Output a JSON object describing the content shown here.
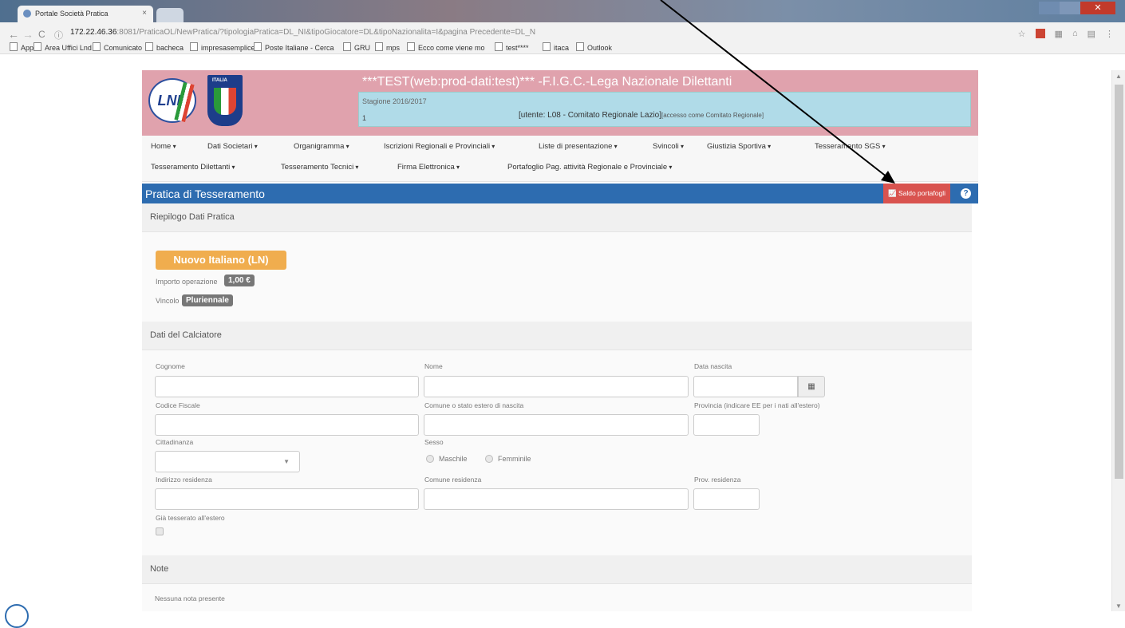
{
  "browser": {
    "tab_title": "Portale Società Pratica",
    "tab_close": "×",
    "close_glyph": "✕",
    "back": "←",
    "forward": "→",
    "reload": "C",
    "url_host": "172.22.46.36",
    "url_rest": ":8081/PraticaOL/NewPratica/?tipologiaPratica=DL_NI&tipoGiocatore=DL&tipoNazionalita=I&pagina Precedente=DL_N",
    "bookmarks": [
      "App",
      "Area Uffici Lnd",
      "Comunicato",
      "bacheca",
      "impresasemplice",
      "Poste Italiane - Cerca",
      "GRU",
      "mps",
      "Ecco come viene mo",
      "test****",
      "itaca",
      "Outlook"
    ]
  },
  "header": {
    "title": "***TEST(web:prod-dati:test)*** -F.I.G.C.-Lega Nazionale Dilettanti",
    "stagione": "Stagione 2016/2017",
    "one": "1",
    "utente": "[utente: L08 - Comitato Regionale Lazio]",
    "accesso": "[accesso come Comitato Regionale]",
    "logo_lnd": "LND",
    "logo_italia": "ITALIA"
  },
  "menu": {
    "row1": [
      "Home",
      "Dati Societari",
      "Organigramma",
      "Iscrizioni Regionali e Provinciali",
      "Liste di presentazione",
      "Svincoli",
      "Giustizia Sportiva",
      "Tesseramento SGS"
    ],
    "row2": [
      "Tesseramento Dilettanti",
      "Tesseramento Tecnici",
      "Firma Elettronica",
      "Portafoglio Pag. attività Regionale e Provinciale"
    ]
  },
  "page": {
    "title": "Pratica di Tesseramento",
    "saldo_label": "Saldo portafogli",
    "help": "?"
  },
  "riepilogo": {
    "heading": "Riepilogo Dati Pratica",
    "tipo": "Nuovo Italiano (LN)",
    "importo_label": "Importo operazione",
    "importo_value": "1,00 €",
    "vincolo_label": "Vincolo",
    "vincolo_value": "Pluriennale"
  },
  "calciatore": {
    "heading": "Dati del Calciatore",
    "cognome": "Cognome",
    "nome": "Nome",
    "data_nascita": "Data nascita",
    "codice_fiscale": "Codice Fiscale",
    "comune_nascita": "Comune o stato estero di nascita",
    "provincia_nascita": "Provincia (indicare EE per i nati all'estero)",
    "cittadinanza": "Cittadinanza",
    "sesso": "Sesso",
    "maschile": "Maschile",
    "femminile": "Femminile",
    "indirizzo": "Indirizzo residenza",
    "comune_residenza": "Comune residenza",
    "prov_residenza": "Prov. residenza",
    "tesserato_estero": "Già tesserato all'estero"
  },
  "note": {
    "heading": "Note",
    "empty": "Nessuna nota presente"
  },
  "colors": {
    "header_bg": "#e0a2ad",
    "titlebar": "#2d6cb0",
    "danger": "#d9534f",
    "warning": "#f0ad4e"
  }
}
